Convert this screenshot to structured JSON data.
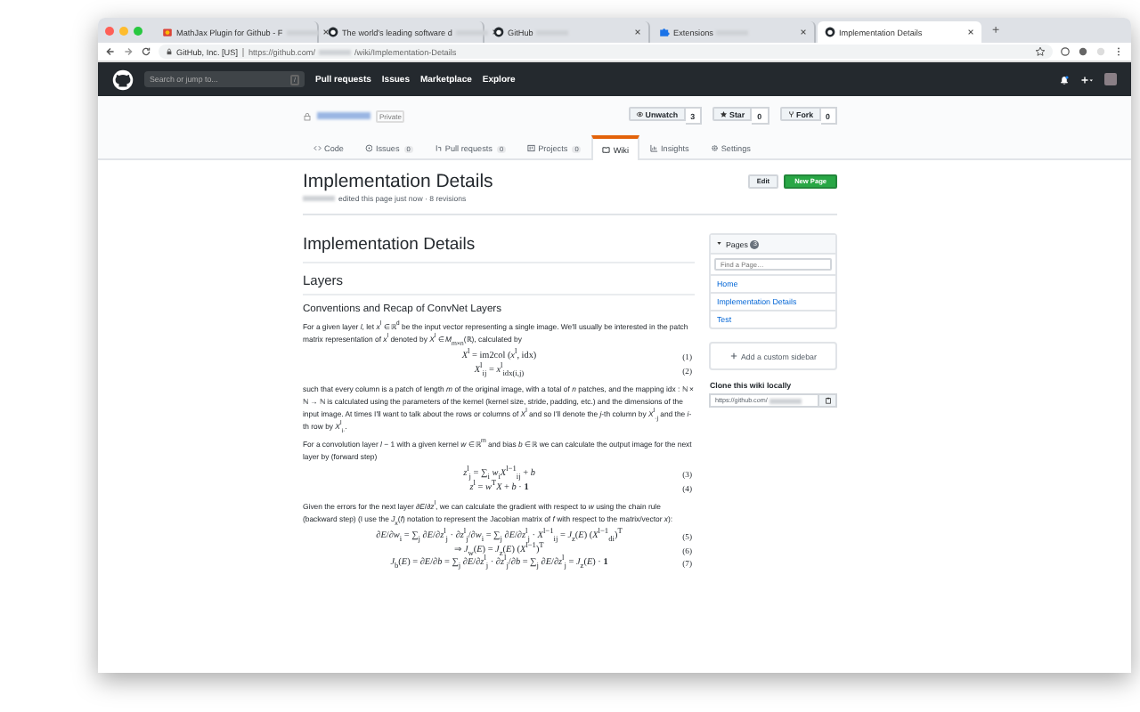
{
  "browser": {
    "tabs": [
      {
        "title": "MathJax Plugin for Github - F",
        "kind": "store",
        "selected": false
      },
      {
        "title": "The world's leading software d",
        "kind": "github",
        "selected": false
      },
      {
        "title": "GitHub",
        "kind": "github",
        "selected": false
      },
      {
        "title": "Extensions",
        "kind": "puzzle",
        "selected": false
      },
      {
        "title": "Implementation Details",
        "kind": "github",
        "selected": true
      }
    ],
    "new_tab": "+",
    "address": {
      "site": "GitHub, Inc. [US]",
      "url_start": "https://github.com/",
      "url_end": "/wiki/Implementation-Details"
    }
  },
  "github": {
    "search_placeholder": "Search or jump to...",
    "search_key": "/",
    "nav": [
      "Pull requests",
      "Issues",
      "Marketplace",
      "Explore"
    ]
  },
  "repo": {
    "visibility": "Private",
    "actions": [
      {
        "label": "Unwatch",
        "kind": "eye",
        "count": "3"
      },
      {
        "label": "Star",
        "kind": "star",
        "count": "0"
      },
      {
        "label": "Fork",
        "kind": "fork",
        "count": "0"
      }
    ],
    "tabs": [
      {
        "label": "Code",
        "kind": "code",
        "selected": false
      },
      {
        "label": "Issues",
        "kind": "issue",
        "count": "0",
        "selected": false
      },
      {
        "label": "Pull requests",
        "kind": "pr",
        "count": "0",
        "selected": false
      },
      {
        "label": "Projects",
        "kind": "project",
        "count": "0",
        "selected": false
      },
      {
        "label": "Wiki",
        "kind": "book",
        "selected": true
      },
      {
        "label": "Insights",
        "kind": "graph",
        "selected": false
      },
      {
        "label": "Settings",
        "kind": "gear",
        "selected": false
      }
    ]
  },
  "page": {
    "title": "Implementation Details",
    "meta": "edited this page just now · 8 revisions",
    "buttons": [
      {
        "label": "Edit",
        "kind": "default"
      },
      {
        "label": "New Page",
        "kind": "primary"
      }
    ]
  },
  "article": {
    "h1": "Implementation Details",
    "h2": "Layers",
    "h3": "Conventions and Recap of ConvNet Layers",
    "body": [
      {
        "kind": "paragraph",
        "text": "For a given layer *l*, let *x*$^{l}$ ∈ ℝ$^{d}$ be the input vector representing a single image. We'll usually be interested in the patch matrix representation of *x*$^{l}$ denoted by *X*$^{l}$ ∈ *M*$_{m×n}$(ℝ), calculated by"
      },
      {
        "kind": "equations",
        "rows": [
          {
            "expr": "*X*$^{l}$ = im2col (*x*$^{l}$, idx)",
            "number": "(1)"
          },
          {
            "expr": "*X*$^{l}$$_{ij}$ = *x*$^{l}$$_{idx(i,j)}$",
            "number": "(2)"
          }
        ]
      },
      {
        "kind": "paragraph",
        "text": "such that every column is a patch of length *m* of the original image, with a total of *n* patches, and the mapping idx : ℕ × ℕ → ℕ is calculated using the parameters of the kernel (kernel size, stride, padding, etc.) and the dimensions of the input image. At times I'll want to talk about the rows or columns of *X*$^{l}$ and so I'll denote the *j*-th column by *X*$^{l}$$_{·j}$ and the *i*-th row by *X*$^{l}$$_{i·}$."
      },
      {
        "kind": "paragraph",
        "text": "For a convolution layer *l* − 1 with a given kernel *w* ∈ ℝ$^{m}$ and bias *b* ∈ ℝ we can calculate the output image for the next layer by (forward step)"
      },
      {
        "kind": "equations",
        "rows": [
          {
            "expr": "*z*$^{l}$$_{j}$ = ∑$_{i}$ *w*$_{i}$*X*$^{l−1}$$_{ij}$ + *b*",
            "number": "(3)"
          },
          {
            "expr": "*z*$^{l}$ = *w*$^{T}$*X* + *b* · **1**",
            "number": "(4)"
          }
        ]
      },
      {
        "kind": "paragraph",
        "text": "Given the errors for the next layer ∂*E*/∂*z*$^{l}$, we can calculate the gradient with respect to *w* using the chain rule (backward step) (I use the *J*$_{x}$(*f*) notation to represent the Jacobian matrix of *f* with respect to the matrix/vector *x*):"
      },
      {
        "kind": "equations",
        "rows": [
          {
            "expr": "∂*E*/∂*w*$_{i}$ = ∑$_{j}$ ∂*E*/∂*z*$^{l}$$_{j}$ · ∂*z*$^{l}$$_{j}$/∂*w*$_{i}$ = ∑$_{j}$ ∂*E*/∂*z*$^{l}$$_{j}$ · *X*$^{l−1}$$_{ij}$ = *J*$_{z}$(*E*) (*X*$^{l−1}$$_{di}$)$^{T}$",
            "number": "(5)"
          },
          {
            "expr": "⇒ *J*$_{w}$(*E*) = *J*$_{z}$(*E*) (*X*$^{l−1}$)$^{T}$",
            "number": "(6)"
          },
          {
            "expr": "*J*$_{b}$(*E*) = ∂*E*/∂*b* = ∑$_{j}$ ∂*E*/∂*z*$^{l}$$_{j}$ · ∂*z*$^{l}$$_{j}$/∂*b* = ∑$_{j}$ ∂*E*/∂*z*$^{l}$$_{j}$ = *J*$_{z}$(*E*) · **1**",
            "number": "(7)"
          }
        ]
      }
    ]
  },
  "sidebar": {
    "pages_title": "Pages",
    "pages_count": "3",
    "find_placeholder": "Find a Page…",
    "pages": [
      "Home",
      "Implementation Details",
      "Test"
    ],
    "add_sidebar": "Add a custom sidebar",
    "clone_title": "Clone this wiki locally",
    "clone_url": "https://github.com/"
  }
}
